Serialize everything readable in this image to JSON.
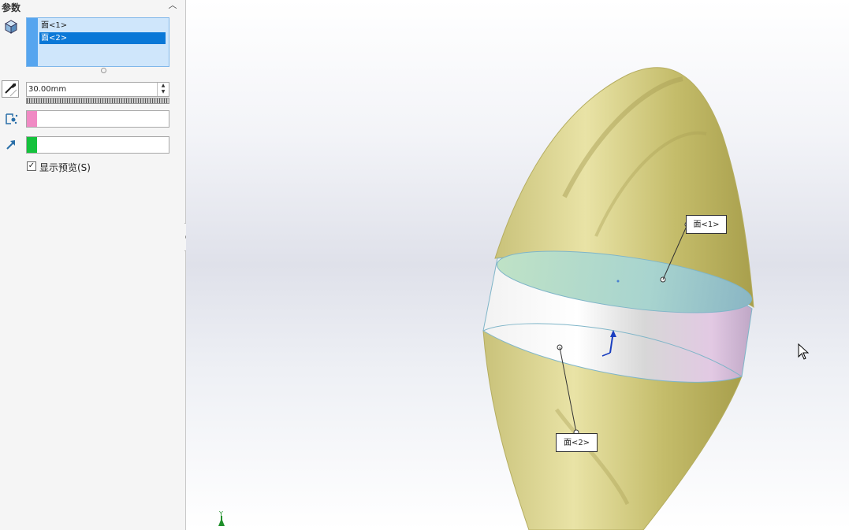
{
  "panel": {
    "section_title": "参数",
    "faces": [
      "面<1>",
      "面<2>"
    ],
    "selected_face_index": 1,
    "distance": "30.00mm",
    "color1": "#f08ac4",
    "color2": "#14c23c",
    "preview_checked": true,
    "preview_label": "显示预览(S)"
  },
  "viewport": {
    "callout1": "面<1>",
    "callout2": "面<2>",
    "triad_label": "Y"
  },
  "icons": {
    "collapse": "chevron-up-icon",
    "faces": "cube-face-icon",
    "distance": "direction-arrow-icon",
    "color1": "color-pick-icon",
    "color2": "arrow-icon"
  }
}
